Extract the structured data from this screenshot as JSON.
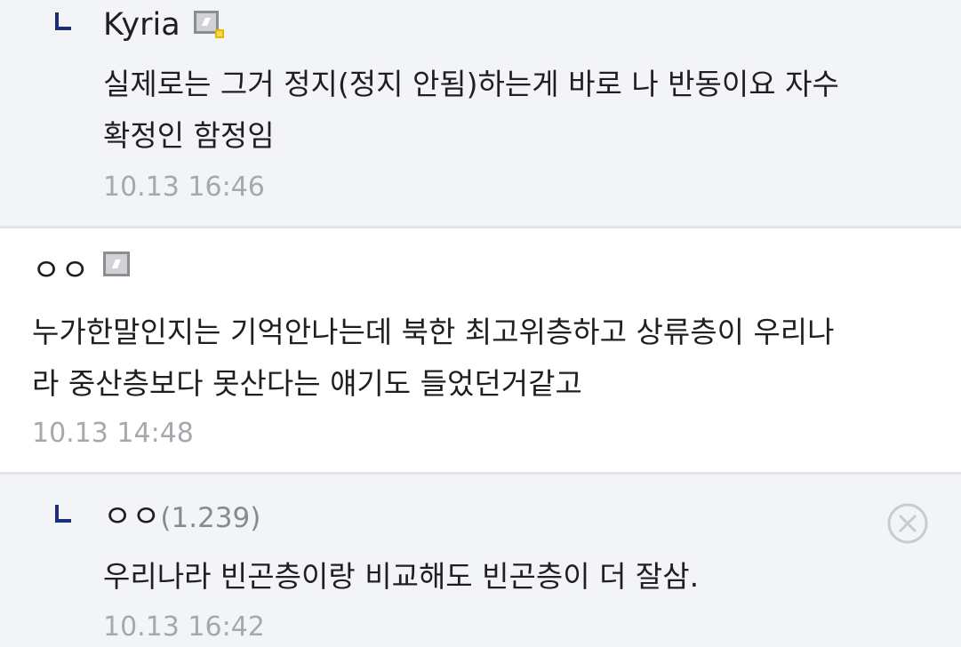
{
  "comments": [
    {
      "type": "reply",
      "author": "Kyria",
      "author_icon": "fixed-nick-icon",
      "text_line1": "실제로는 그거 정지(정지 안됨)하는게 바로 나 반동이요 자수",
      "text_line2": "확정인 함정임",
      "timestamp": "10.13 16:46"
    },
    {
      "type": "comment",
      "author": "ㅇㅇ",
      "author_icon": "fixed-nick-icon",
      "text_line1": "누가한말인지는 기억안나는데 북한 최고위층하고 상류층이 우리나",
      "text_line2": "라 중산층보다 못산다는 얘기도 들었던거같고",
      "timestamp": "10.13 14:48"
    },
    {
      "type": "reply",
      "author": "ㅇㅇ",
      "ip": "(1.239)",
      "text_line1": "우리나라 빈곤층이랑 비교해도 빈곤층이 더 잘삼.",
      "timestamp": "10.13 16:42",
      "delete_icon": "close-circle-icon"
    }
  ],
  "colors": {
    "reply_bg": "#f3f4f7",
    "comment_bg": "#ffffff",
    "divider": "#e2e3e7",
    "reply_arrow": "#1c2e7a",
    "timestamp": "#a6a8ad"
  }
}
